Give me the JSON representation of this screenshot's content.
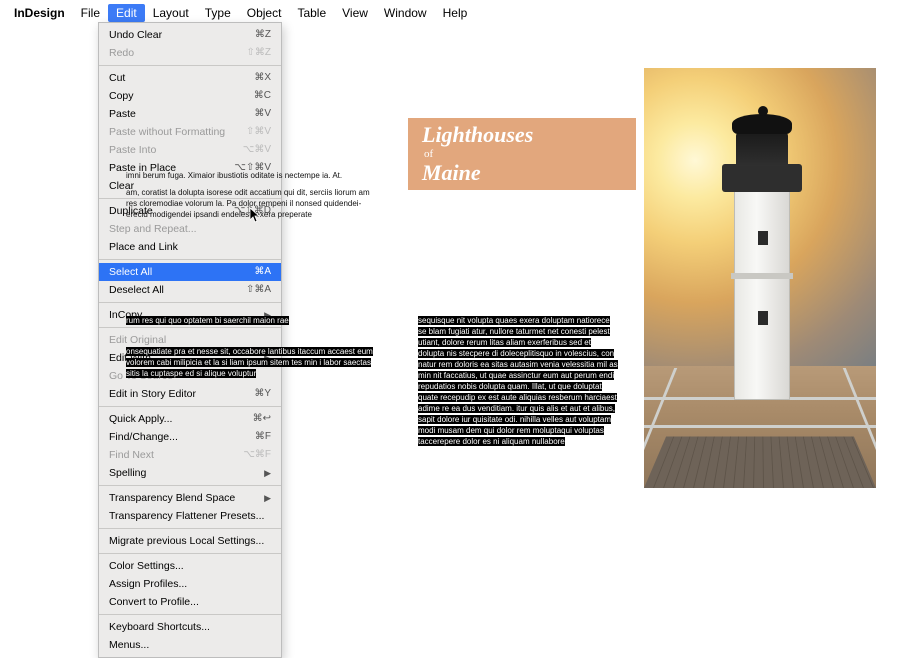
{
  "menubar": {
    "appname": "InDesign",
    "items": [
      "File",
      "Edit",
      "Layout",
      "Type",
      "Object",
      "Table",
      "View",
      "Window",
      "Help"
    ],
    "activeIndex": 1
  },
  "dropdown": {
    "groups": [
      [
        {
          "label": "Undo Clear",
          "short": "⌘Z",
          "disabled": false
        },
        {
          "label": "Redo",
          "short": "⇧⌘Z",
          "disabled": true
        }
      ],
      [
        {
          "label": "Cut",
          "short": "⌘X"
        },
        {
          "label": "Copy",
          "short": "⌘C"
        },
        {
          "label": "Paste",
          "short": "⌘V"
        },
        {
          "label": "Paste without Formatting",
          "short": "⇧⌘V",
          "disabled": true
        },
        {
          "label": "Paste Into",
          "short": "⌥⌘V",
          "disabled": true
        },
        {
          "label": "Paste in Place",
          "short": "⌥⇧⌘V"
        },
        {
          "label": "Clear",
          "short": ""
        }
      ],
      [
        {
          "label": "Duplicate",
          "short": "⌥⇧⌘D"
        },
        {
          "label": "Step and Repeat...",
          "short": "",
          "disabled": true
        },
        {
          "label": "Place and Link",
          "short": ""
        }
      ],
      [
        {
          "label": "Select All",
          "short": "⌘A",
          "highlight": true
        },
        {
          "label": "Deselect All",
          "short": "⇧⌘A"
        }
      ],
      [
        {
          "label": "InCopy",
          "short": "▶"
        }
      ],
      [
        {
          "label": "Edit Original",
          "short": "",
          "disabled": true
        },
        {
          "label": "Edit With",
          "short": "▶"
        },
        {
          "label": "Go To Source",
          "short": "",
          "disabled": true
        },
        {
          "label": "Edit in Story Editor",
          "short": "⌘Y"
        }
      ],
      [
        {
          "label": "Quick Apply...",
          "short": "⌘↩"
        },
        {
          "label": "Find/Change...",
          "short": "⌘F"
        },
        {
          "label": "Find Next",
          "short": "⌥⌘F",
          "disabled": true
        },
        {
          "label": "Spelling",
          "short": "▶"
        }
      ],
      [
        {
          "label": "Transparency Blend Space",
          "short": "▶"
        },
        {
          "label": "Transparency Flattener Presets...",
          "short": ""
        }
      ],
      [
        {
          "label": "Migrate previous Local Settings...",
          "short": ""
        }
      ],
      [
        {
          "label": "Color Settings...",
          "short": ""
        },
        {
          "label": "Assign Profiles...",
          "short": ""
        },
        {
          "label": "Convert to Profile...",
          "short": ""
        }
      ],
      [
        {
          "label": "Keyboard Shortcuts...",
          "short": ""
        },
        {
          "label": "Menus...",
          "short": ""
        }
      ]
    ]
  },
  "doc": {
    "title": {
      "line1": "Lighthouses",
      "line2": "of",
      "line3": "Maine"
    },
    "para1": "imni berum fuga. Ximaior ibustiotis oditate is nectempe ia. At.",
    "para2": "am, coratist la dolupta isorese odit accatium qui dit, serciis liorum am res cloremodiae volorum la. Pa dolor rempeni il nonsed quidendei-erecid modigendei ipsandi endelesti exera preperate",
    "hl1": "rum res qui quo optatem bi saerchil maion rae",
    "hl2": "onsequatiate pra et nesse sit, occabore lantibus itaccum accaest eum volorem cabi milipicia et la si liam ipsum sitem tes min i labor saectas sitis la cuptaspe ed si alique voluptur",
    "hl3": "sequisque nit volupta quaes exera doluptam natiorece se blam fugiati atur, nullore taturmet net conesti pelest utiant, dolore rerum litas aliam exerferibus sed et dolupta nis stecpere di doleceplitisquo in volescius, con natur rem doloris ea sitas autasim venia velessitia mil as min nit faccatius, ut quae assinctur eum aut perum endi repudatios nobis dolupta quam. Illat, ut que doluptat quate recepudip ex est aute aliquias resberum harciaest adime re ea dus venditiam. itur quis alis et aut et alibus, sapit dolore iur quisitate odi. nihilla velles aut voluptam modi musam dem qui dolor rem moluptaqui voluptas taccerepere dolor es ni aliquam nullabore",
    "colors": {
      "titleboxBg": "#e2a77d",
      "highlightBg": "#000000",
      "highlightFg": "#ffffff",
      "menuHighlight": "#2d73f5"
    }
  }
}
